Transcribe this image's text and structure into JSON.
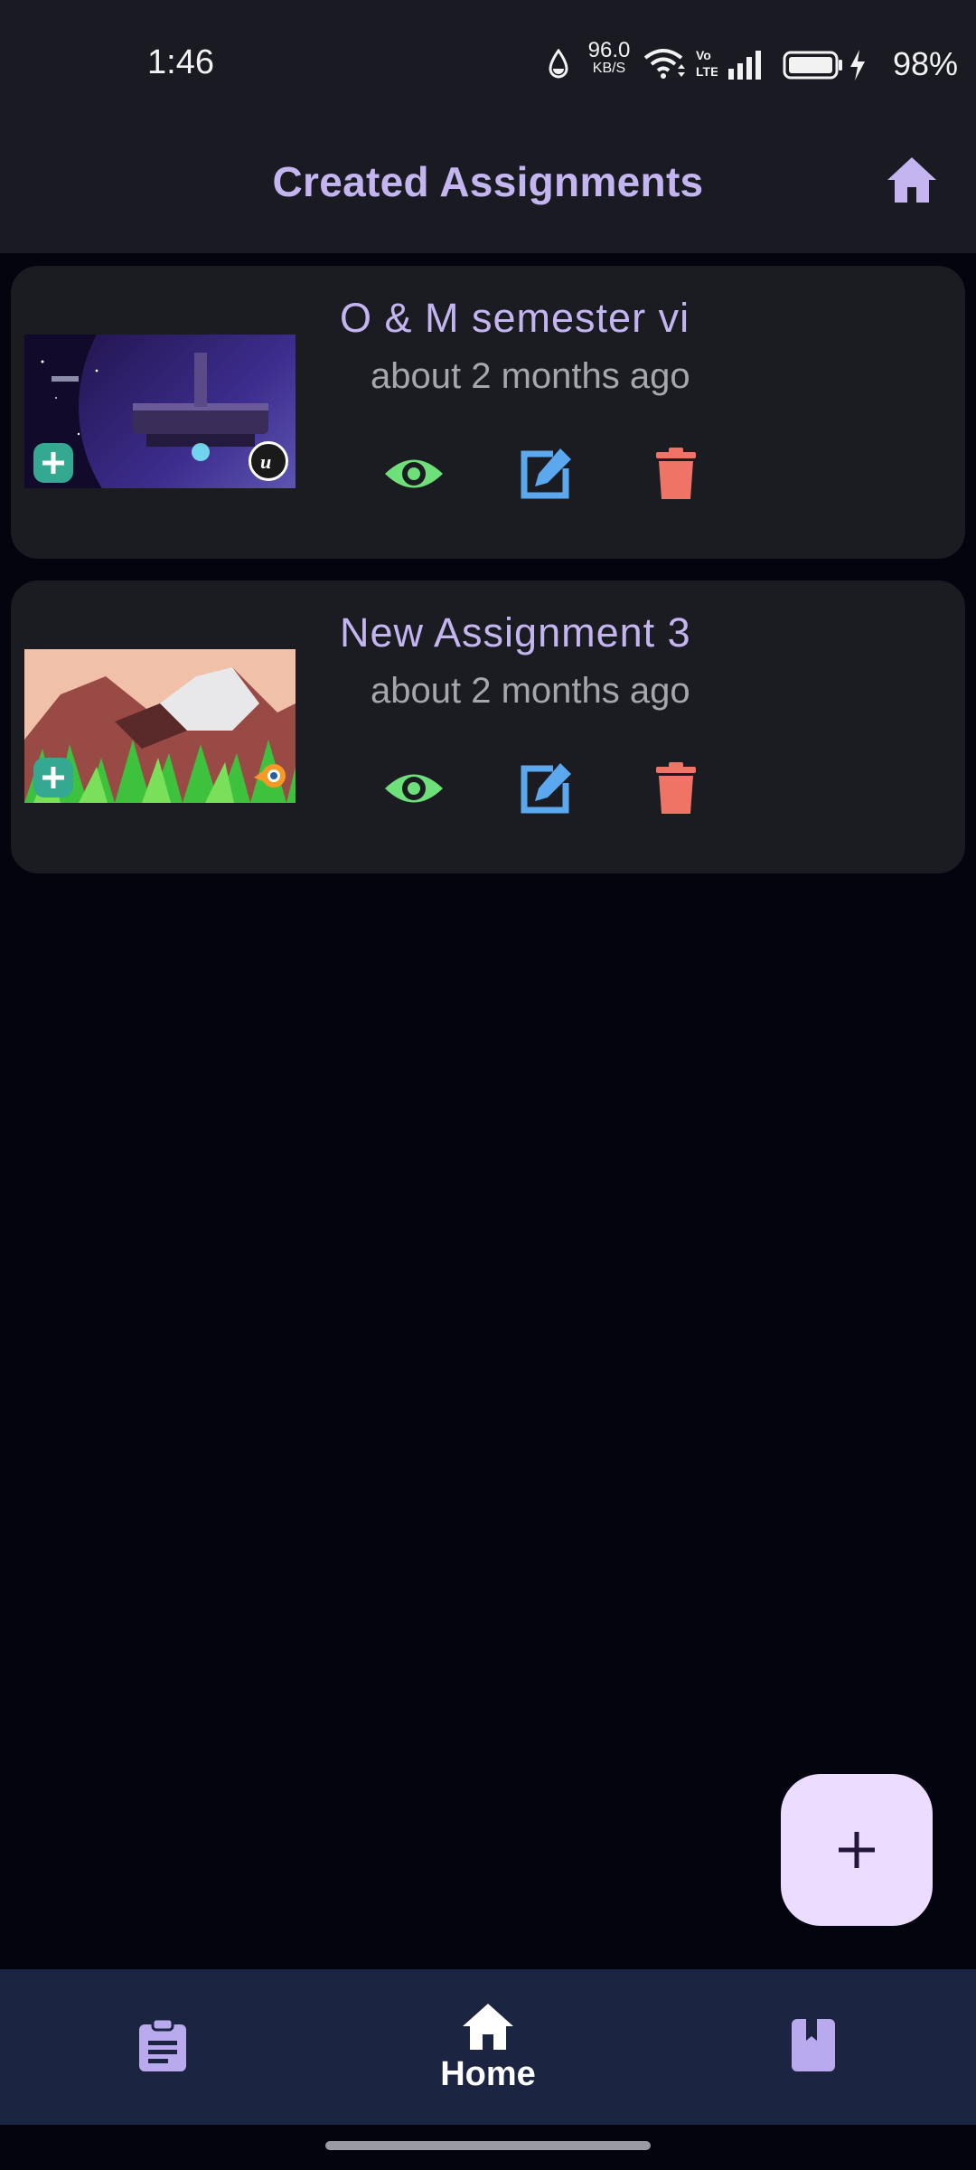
{
  "status_bar": {
    "time": "1:46",
    "net_speed_value": "96.0",
    "net_speed_unit": "KB/S",
    "battery_percent": "98%",
    "icons": [
      "water-drop-icon",
      "wifi-icon",
      "volte-icon",
      "signal-icon",
      "battery-icon",
      "charging-icon"
    ]
  },
  "app_bar": {
    "title": "Created Assignments",
    "home_icon": "home-icon"
  },
  "assignments": [
    {
      "title": "O & M semester vi",
      "time": "about 2 months ago",
      "thumbnail": "space-station-scene",
      "badge_engine": "unreal-engine-logo"
    },
    {
      "title": "New Assignment 3",
      "time": "about 2 months ago",
      "thumbnail": "low-poly-mountain-scene",
      "badge_engine": "blender-logo"
    }
  ],
  "actions": {
    "view_icon": "eye-icon",
    "edit_icon": "edit-icon",
    "delete_icon": "trash-icon"
  },
  "fab": {
    "icon": "plus-icon"
  },
  "bottom_nav": {
    "items": [
      {
        "icon": "assignment-icon",
        "label": ""
      },
      {
        "icon": "home-icon",
        "label": "Home"
      },
      {
        "icon": "book-icon",
        "label": ""
      }
    ]
  },
  "colors": {
    "background": "#04040f",
    "surface": "#1b1b22",
    "accent": "#c4b5f0",
    "view_green": "#6ee07a",
    "edit_blue": "#5ca8ee",
    "delete_red": "#ef7466",
    "nav_bg": "#1b2542",
    "fab_bg": "#ecdcff"
  }
}
